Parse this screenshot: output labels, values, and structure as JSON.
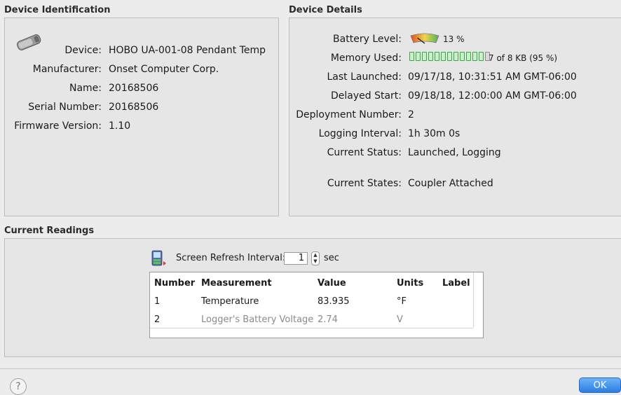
{
  "device_identification": {
    "title": "Device Identification",
    "fields": [
      {
        "label": "Device:",
        "value": "HOBO UA-001-08 Pendant Temp"
      },
      {
        "label": "Manufacturer:",
        "value": "Onset Computer Corp."
      },
      {
        "label": "Name:",
        "value": "20168506"
      },
      {
        "label": "Serial Number:",
        "value": "20168506"
      },
      {
        "label": "Firmware Version:",
        "value": "1.10"
      }
    ],
    "icon": "pendant-logger-icon"
  },
  "device_details": {
    "title": "Device Details",
    "battery_label": "Battery Level:",
    "battery_percent_text": "13 %",
    "battery_level": 0.13,
    "memory_label": "Memory Used:",
    "memory_text": "7 of 8 KB (95 %)",
    "memory_fraction": 0.95,
    "fields": [
      {
        "label": "Last Launched:",
        "value": "09/17/18, 10:31:51 AM GMT-06:00"
      },
      {
        "label": "Delayed Start:",
        "value": "09/18/18, 12:00:00 AM GMT-06:00"
      },
      {
        "label": "Deployment Number:",
        "value": "2"
      },
      {
        "label": "Logging Interval:",
        "value": "1h 30m 0s"
      },
      {
        "label": "Current Status:",
        "value": "Launched, Logging"
      },
      {
        "label": "Current States:",
        "value": "Coupler Attached"
      }
    ]
  },
  "current_readings": {
    "title": "Current Readings",
    "refresh_label": "Screen Refresh Interval:",
    "refresh_value": "1",
    "refresh_unit": "sec",
    "columns": [
      "Number",
      "Measurement",
      "Value",
      "Units",
      "Label"
    ],
    "rows": [
      {
        "number": "1",
        "measurement": "Temperature",
        "value": "83.935",
        "units": "°F",
        "label": ""
      },
      {
        "number": "2",
        "measurement": "Logger's Battery Voltage",
        "value": "2.74",
        "units": "V",
        "label": ""
      }
    ]
  },
  "footer": {
    "help": "?",
    "ok": "OK"
  },
  "colors": {
    "ok_button": "#2a7de1",
    "memory_segment": "#3fa34d",
    "battery_low": "#e04b2b"
  }
}
